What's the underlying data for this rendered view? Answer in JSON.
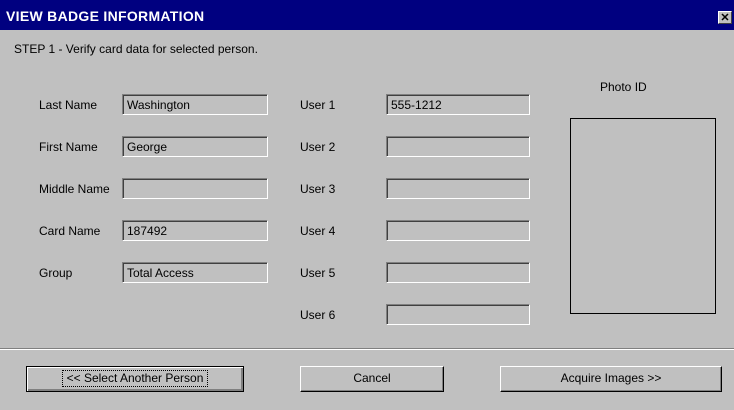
{
  "window": {
    "title": "VIEW BADGE INFORMATION",
    "close_glyph": "✕"
  },
  "step_text": "STEP 1 - Verify card data for selected person.",
  "person": {
    "last_name_label": "Last Name",
    "last_name": "Washington",
    "first_name_label": "First Name",
    "first_name": "George",
    "middle_name_label": "Middle Name",
    "middle_name": "",
    "card_name_label": "Card Name",
    "card_name": "187492",
    "group_label": "Group",
    "group": "Total Access"
  },
  "user_fields": [
    {
      "label": "User 1",
      "value": "555-1212"
    },
    {
      "label": "User 2",
      "value": ""
    },
    {
      "label": "User 3",
      "value": ""
    },
    {
      "label": "User 4",
      "value": ""
    },
    {
      "label": "User 5",
      "value": ""
    },
    {
      "label": "User 6",
      "value": ""
    }
  ],
  "photo": {
    "label": "Photo ID"
  },
  "buttons": {
    "select_another": "<< Select Another Person",
    "cancel": "Cancel",
    "acquire": "Acquire Images >>"
  }
}
